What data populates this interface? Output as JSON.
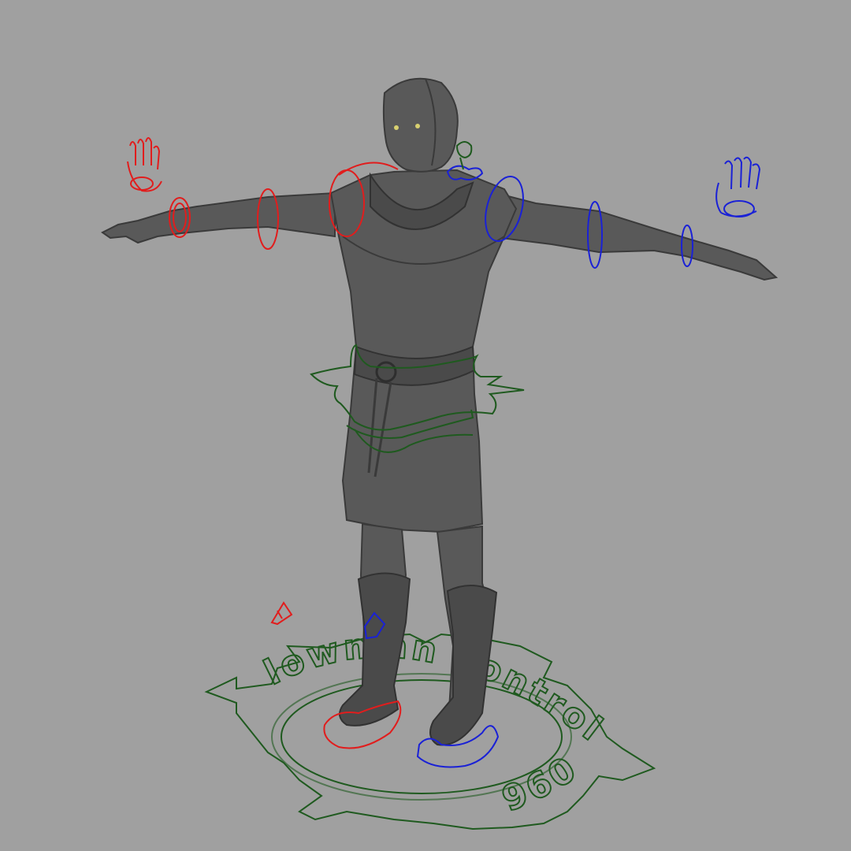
{
  "viewport": {
    "background": "#a0a0a0"
  },
  "controls": {
    "root_ring_text_top": "lowman control",
    "root_ring_text_bottom": "960",
    "left_color": "#e11d1d",
    "right_color": "#1a21d6",
    "center_color": "#1f5a1f"
  },
  "icons": [
    "left-hand-control-icon",
    "right-hand-control-icon",
    "left-foot-flag-icon",
    "right-foot-flag-icon"
  ]
}
